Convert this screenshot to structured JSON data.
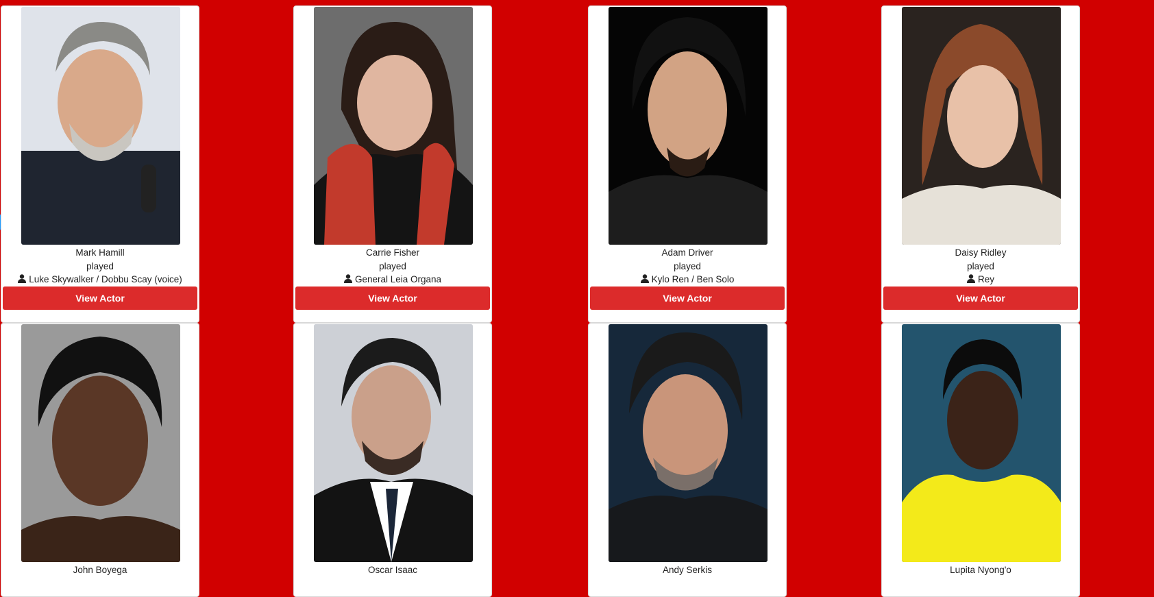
{
  "colors": {
    "page_background": "#d10000",
    "button_background": "#dc2b2b",
    "card_background": "#ffffff"
  },
  "actors": [
    {
      "name": "Mark Hamill",
      "played_label": "played",
      "role": "Luke Skywalker / Dobbu Scay (voice)",
      "button_label": "View Actor"
    },
    {
      "name": "Carrie Fisher",
      "played_label": "played",
      "role": "General Leia Organa",
      "button_label": "View Actor"
    },
    {
      "name": "Adam Driver",
      "played_label": "played",
      "role": "Kylo Ren / Ben Solo",
      "button_label": "View Actor"
    },
    {
      "name": "Daisy Ridley",
      "played_label": "played",
      "role": "Rey",
      "button_label": "View Actor"
    },
    {
      "name": "John Boyega",
      "played_label": "",
      "role": "",
      "button_label": ""
    },
    {
      "name": "Oscar Isaac",
      "played_label": "",
      "role": "",
      "button_label": ""
    },
    {
      "name": "Andy Serkis",
      "played_label": "",
      "role": "",
      "button_label": ""
    },
    {
      "name": "Lupita Nyong'o",
      "played_label": "",
      "role": "",
      "button_label": ""
    }
  ],
  "icons": {
    "role": "user-icon"
  }
}
